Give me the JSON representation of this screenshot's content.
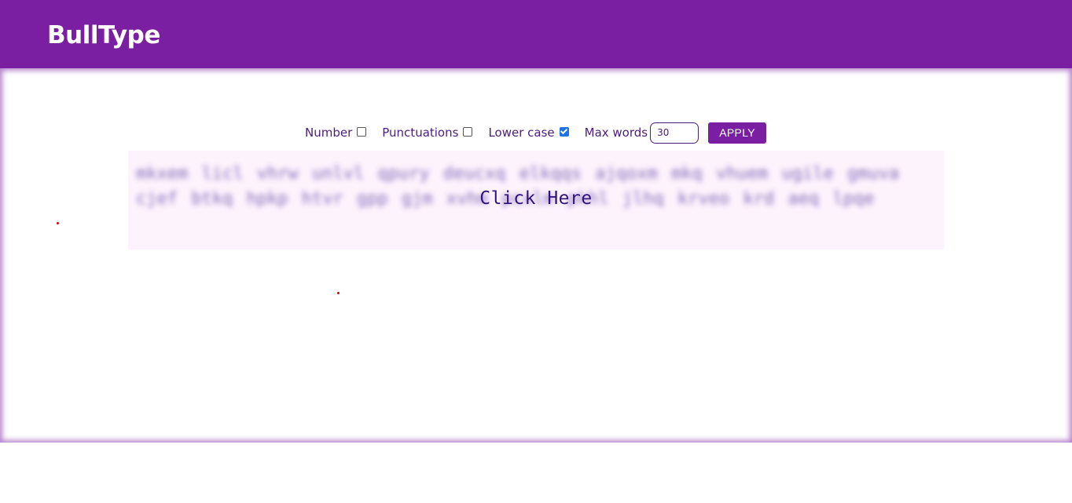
{
  "header": {
    "title": "BullType",
    "background_color": "#7a1fa2"
  },
  "controls": {
    "number": {
      "label": "Number",
      "checked": false
    },
    "punctuations": {
      "label": "Punctuations",
      "checked": false
    },
    "lower_case": {
      "label": "Lower case",
      "checked": true
    },
    "max_words": {
      "label": "Max words",
      "value": "30"
    },
    "apply_label": "APPLY"
  },
  "typing_area": {
    "words_text": "mkxem licl vhrw unlvl qpury deucxq elkqqs ajqoxm mkq vhuem ugile gmuva cjef btkq hpkp htvr gpp gjm xvhm pcxlm pkhl jlhq krveo krd aeq lpqe",
    "overlay_label": "Click Here",
    "background_color": "#fdf3fd"
  },
  "markers": {
    "color": "#d40000"
  }
}
